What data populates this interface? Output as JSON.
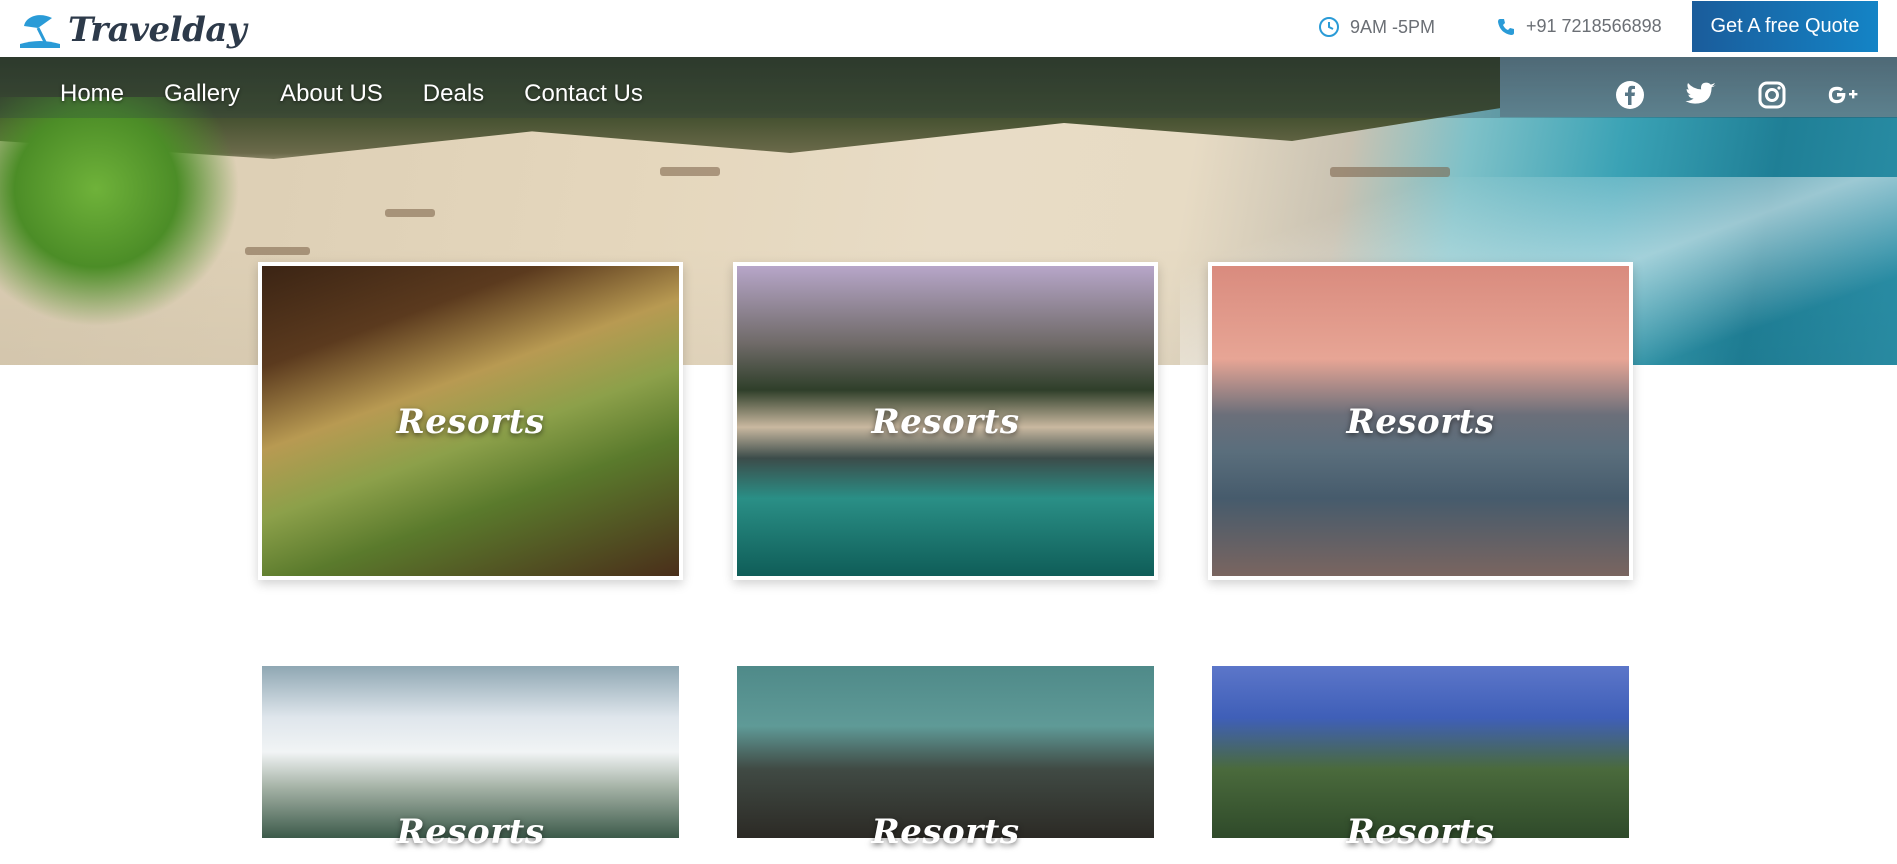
{
  "brand": {
    "name": "Travelday"
  },
  "topbar": {
    "hours": "9AM -5PM",
    "phone": "+91 7218566898",
    "cta_label": "Get A free Quote"
  },
  "nav": {
    "items": [
      "Home",
      "Gallery",
      "About US",
      "Deals",
      "Contact Us"
    ]
  },
  "social": {
    "icons": [
      "facebook-icon",
      "twitter-icon",
      "instagram-icon",
      "google-plus-icon"
    ]
  },
  "cards": [
    {
      "label": "Resorts"
    },
    {
      "label": "Resorts"
    },
    {
      "label": "Resorts"
    },
    {
      "label": "Resorts"
    },
    {
      "label": "Resorts"
    },
    {
      "label": "Resorts"
    }
  ],
  "colors": {
    "accent": "#1484c6",
    "logo_text": "#2d3a4a",
    "topbar_text": "#6b6f75"
  }
}
